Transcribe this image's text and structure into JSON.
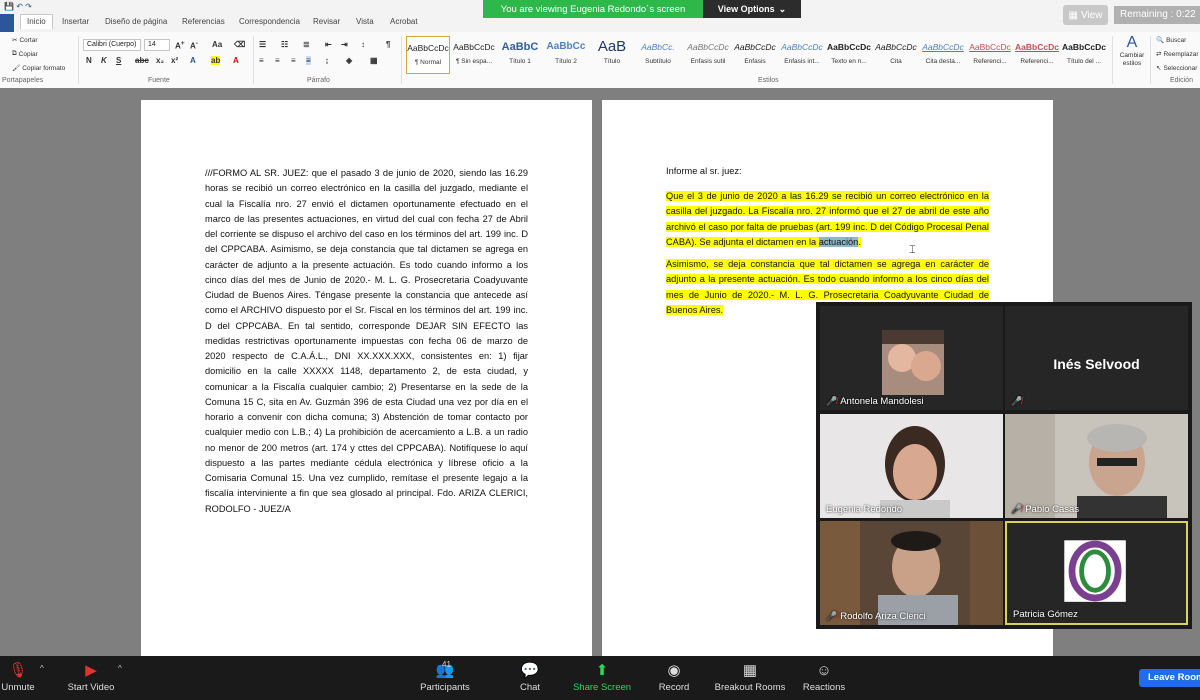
{
  "zoom_banner": {
    "message": "You are viewing Eugenia Redondo´s screen",
    "view_options": "View Options"
  },
  "zoom_top": {
    "view_label": "View",
    "remaining": "Remaining : 0:22"
  },
  "word": {
    "tabs": [
      "Inicio",
      "Insertar",
      "Diseño de página",
      "Referencias",
      "Correspondencia",
      "Revisar",
      "Vista",
      "Acrobat"
    ],
    "clipboard": {
      "cut": "Cortar",
      "copy": "Copiar",
      "format_painter": "Copiar formato",
      "label": "Portapapeles"
    },
    "font": {
      "family": "Calibri (Cuerpo)",
      "size": "14",
      "label": "Fuente"
    },
    "paragraph_label": "Párrafo",
    "styles": [
      {
        "preview": "AaBbCcDc",
        "name": "¶ Normal"
      },
      {
        "preview": "AaBbCcDc",
        "name": "¶ Sin espa..."
      },
      {
        "preview": "AaBbC",
        "name": "Título 1"
      },
      {
        "preview": "AaBbCc",
        "name": "Título 2"
      },
      {
        "preview": "AaB",
        "name": "Título"
      },
      {
        "preview": "AaBbCc.",
        "name": "Subtítulo"
      },
      {
        "preview": "AaBbCcDc",
        "name": "Énfasis sutil"
      },
      {
        "preview": "AaBbCcDc",
        "name": "Énfasis"
      },
      {
        "preview": "AaBbCcDc",
        "name": "Énfasis int..."
      },
      {
        "preview": "AaBbCcDc",
        "name": "Texto en n..."
      },
      {
        "preview": "AaBbCcDc",
        "name": "Cita"
      },
      {
        "preview": "AaBbCcDc",
        "name": "Cita desta..."
      },
      {
        "preview": "AaBbCcDc",
        "name": "Referenci..."
      },
      {
        "preview": "AaBbCcDc",
        "name": "Referenci..."
      },
      {
        "preview": "AaBbCcDc",
        "name": "Título del ..."
      }
    ],
    "styles_label": "Estilos",
    "change_styles": "Cambiar estilos",
    "editing": {
      "find": "Buscar",
      "replace": "Reemplazar",
      "select": "Seleccionar",
      "label": "Edición"
    }
  },
  "doc": {
    "page1_text": "///FORMO AL SR. JUEZ: que el pasado 3 de junio de 2020, siendo las 16.29 horas se recibió un correo electrónico en la casilla del juzgado, mediante el cual la Fiscalía nro. 27 envió el dictamen oportunamente efectuado en el marco de las presentes actuaciones, en virtud del cual con fecha 27 de Abril del corriente se dispuso el archivo del caso en los términos del art. 199 inc. D del CPPCABA. Asimismo, se deja constancia que tal dictamen se agrega en carácter de adjunto a la presente actuación. Es todo cuando informo a los cinco días del mes de Junio de 2020.- M. L. G. Prosecretaria Coadyuvante Ciudad de Buenos Aires. Téngase presente la constancia que antecede así como el ARCHIVO dispuesto por el Sr. Fiscal en los términos del art. 199 inc. D del CPPCABA. En tal sentido, corresponde DEJAR SIN EFECTO las medidas restrictivas oportunamente impuestas con fecha 06 de marzo de 2020 respecto de C.A.Á.L., DNI XX.XXX.XXX, consistentes en: 1) fijar domicilio en la calle XXXXX 1148, departamento 2, de esta ciudad, y comunicar a la Fiscalía cualquier cambio; 2) Presentarse en la sede de la Comuna 15 C, sita en Av. Guzmán 396 de esta Ciudad una vez por día en el horario a convenir con dicha comuna; 3) Abstención de tomar contacto por cualquier medio con L.B.; 4) La prohibición de acercamiento a L.B. a un radio no menor de 200 metros (art. 174 y cttes del CPPCABA). Notifíquese lo aquí dispuesto a las partes mediante cédula electrónica y líbrese oficio a la Comisaria Comunal 15. Una vez cumplido, remítase el presente legajo a la fiscalía interviniente a fin que sea glosado al principal. Fdo. ARIZA CLERICI, RODOLFO - JUEZ/A",
    "page2_heading": "Informe al sr. juez:",
    "page2_para1_before": "Que el 3 de junio de 2020 a las 16.29 se recibió un correo electrónico en la casilla del juzgado. La Fiscalía nro. 27 informó que el 27 de abril de este año archivó el caso por falta de pruebas (art. 199 inc. D del Código Procesal Penal CABA). Se adjunta el dictamen en la ",
    "page2_para1_selected": "actuación",
    "page2_para1_after": ".",
    "page2_para2": "Asimismo, se deja constancia que tal dictamen se agrega en carácter de adjunto a la presente actuación. Es todo cuando informo a los cinco días del mes de Junio de 2020.- M. L. G. Prosecretaria Coadyuvante Ciudad de Buenos Aires."
  },
  "participants": [
    {
      "name": "Antonela Mandolesi"
    },
    {
      "name": "Inés Selvood"
    },
    {
      "name": "Eugenia Redondo"
    },
    {
      "name": "Pablo Casas"
    },
    {
      "name": "Rodolfo Ariza Clerici"
    },
    {
      "name": "Patricia Gómez"
    }
  ],
  "toolbar": {
    "unmute": "Unmute",
    "start_video": "Start Video",
    "participants": "Participants",
    "participant_count": "41",
    "chat": "Chat",
    "share_screen": "Share Screen",
    "record": "Record",
    "breakout_rooms": "Breakout Rooms",
    "reactions": "Reactions",
    "leave": "Leave Room"
  },
  "colors": {
    "zoom_green": "#2fb84a",
    "highlight": "#ffff00",
    "leave_blue": "#1f6dea",
    "word_blue": "#2b579a",
    "active_speaker": "#d8d25a"
  }
}
